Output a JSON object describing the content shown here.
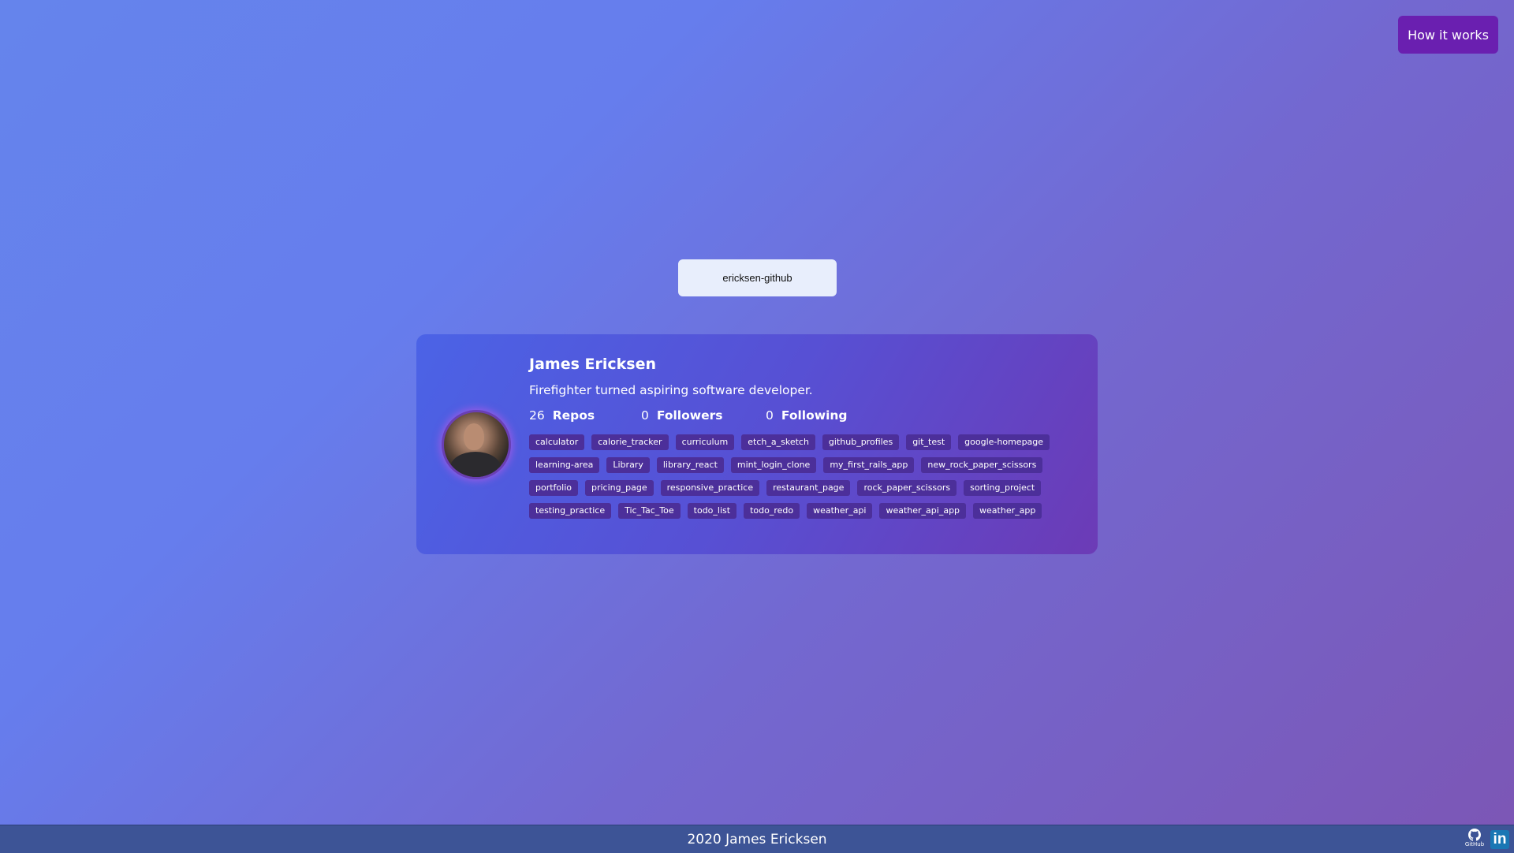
{
  "header": {
    "how_it_works_label": "How it works"
  },
  "search": {
    "value": "ericksen-github"
  },
  "profile": {
    "name": "James Ericksen",
    "bio": "Firefighter turned aspiring software developer.",
    "stats": {
      "repos_count": "26",
      "repos_label": "Repos",
      "followers_count": "0",
      "followers_label": "Followers",
      "following_count": "0",
      "following_label": "Following"
    },
    "repos": [
      "calculator",
      "calorie_tracker",
      "curriculum",
      "etch_a_sketch",
      "github_profiles",
      "git_test",
      "google-homepage",
      "learning-area",
      "Library",
      "library_react",
      "mint_login_clone",
      "my_first_rails_app",
      "new_rock_paper_scissors",
      "portfolio",
      "pricing_page",
      "responsive_practice",
      "restaurant_page",
      "rock_paper_scissors",
      "sorting_project",
      "testing_practice",
      "Tic_Tac_Toe",
      "todo_list",
      "todo_redo",
      "weather_api",
      "weather_api_app",
      "weather_app"
    ]
  },
  "footer": {
    "copyright": "2020 James Ericksen",
    "github_label": "GitHub",
    "linkedin_label": "in"
  },
  "colors": {
    "accent": "#6a1fb0",
    "repo_badge": "#4c2f9a",
    "footer_bg": "#3d5496"
  }
}
